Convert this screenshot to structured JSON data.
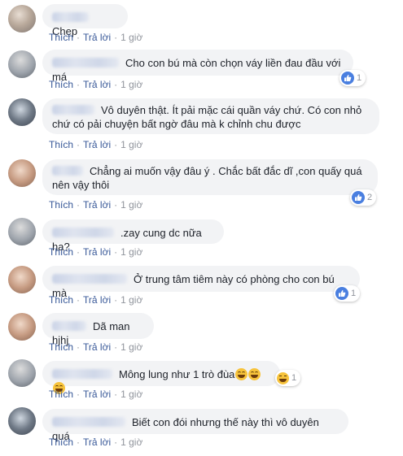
{
  "actions": {
    "like": "Thích",
    "reply": "Trả lời",
    "separator": "·"
  },
  "comments": [
    {
      "text": "Chẹp",
      "time": "1 giờ"
    },
    {
      "text": "Cho con bú mà còn chọn váy liền đau đầu với má",
      "time": "1 giờ",
      "reaction": {
        "type": "like-icon",
        "count": "1"
      }
    },
    {
      "text": "Vô duyên thật. Ít pải mặc cái quần váy chứ. Có con nhỏ chứ có pải chuyện bất ngờ đâu mà k chỉnh chu được",
      "time": "1 giờ"
    },
    {
      "text": "Chẳng ai muốn vậy đâu ý . Chắc bất đắc dĩ ,con quấy quá nên vậy thôi",
      "time": "1 giờ",
      "reaction": {
        "type": "like-icon",
        "count": "2"
      }
    },
    {
      "text": ".zay cung dc nữa ha?",
      "time": "1 giờ"
    },
    {
      "text": "Ở trung tâm tiêm này có phòng cho con bú mà",
      "time": "1 giờ",
      "reaction": {
        "type": "like-icon",
        "count": "1"
      }
    },
    {
      "text": "Dã man hjhj",
      "time": "1 giờ"
    },
    {
      "text": "Mông lung như 1 trò đùa",
      "time": "1 giờ",
      "emoji": "haha-emoji",
      "reaction": {
        "type": "haha-icon",
        "count": "1"
      }
    },
    {
      "text": "Biết con đói nhưng thế này thì vô duyên quá",
      "time": "1 giờ"
    }
  ]
}
